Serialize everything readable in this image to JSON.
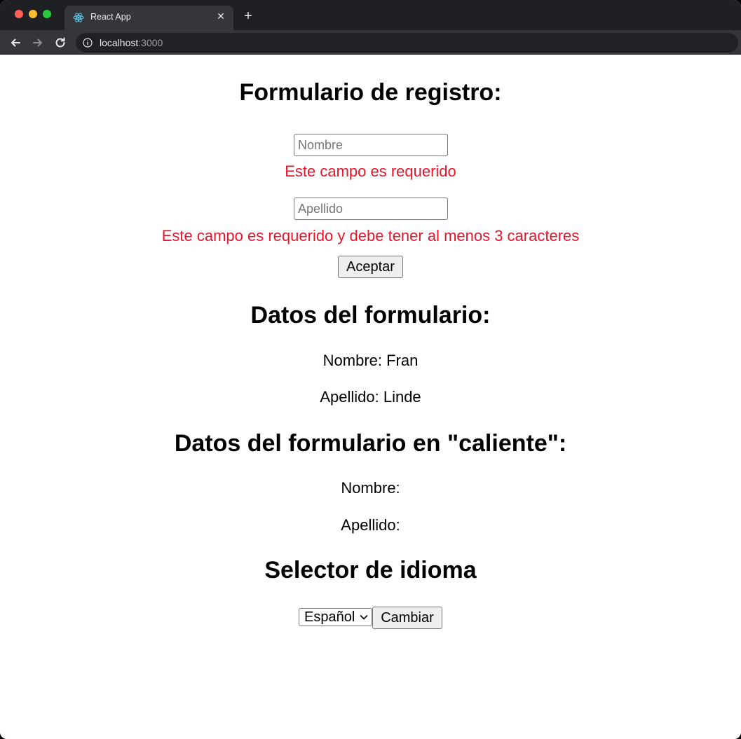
{
  "browser": {
    "tab_title": "React App",
    "close_glyph": "✕",
    "new_tab_glyph": "+",
    "url_host": "localhost",
    "url_port": ":3000"
  },
  "form": {
    "title": "Formulario de registro:",
    "nombre_placeholder": "Nombre",
    "nombre_error": "Este campo es requerido",
    "apellido_placeholder": "Apellido",
    "apellido_error": "Este campo es requerido y debe tener al menos 3 caracteres",
    "submit_label": "Aceptar"
  },
  "submitted": {
    "title": "Datos del formulario:",
    "nombre": "Nombre: Fran",
    "apellido": "Apellido: Linde"
  },
  "live": {
    "title": "Datos del formulario en \"caliente\":",
    "nombre": "Nombre:",
    "apellido": "Apellido:"
  },
  "language": {
    "title": "Selector de idioma",
    "selected": "Español",
    "change_label": "Cambiar"
  },
  "colors": {
    "error": "#e8162a",
    "chrome_bg": "#1f2023",
    "toolbar_bg": "#35363a"
  }
}
